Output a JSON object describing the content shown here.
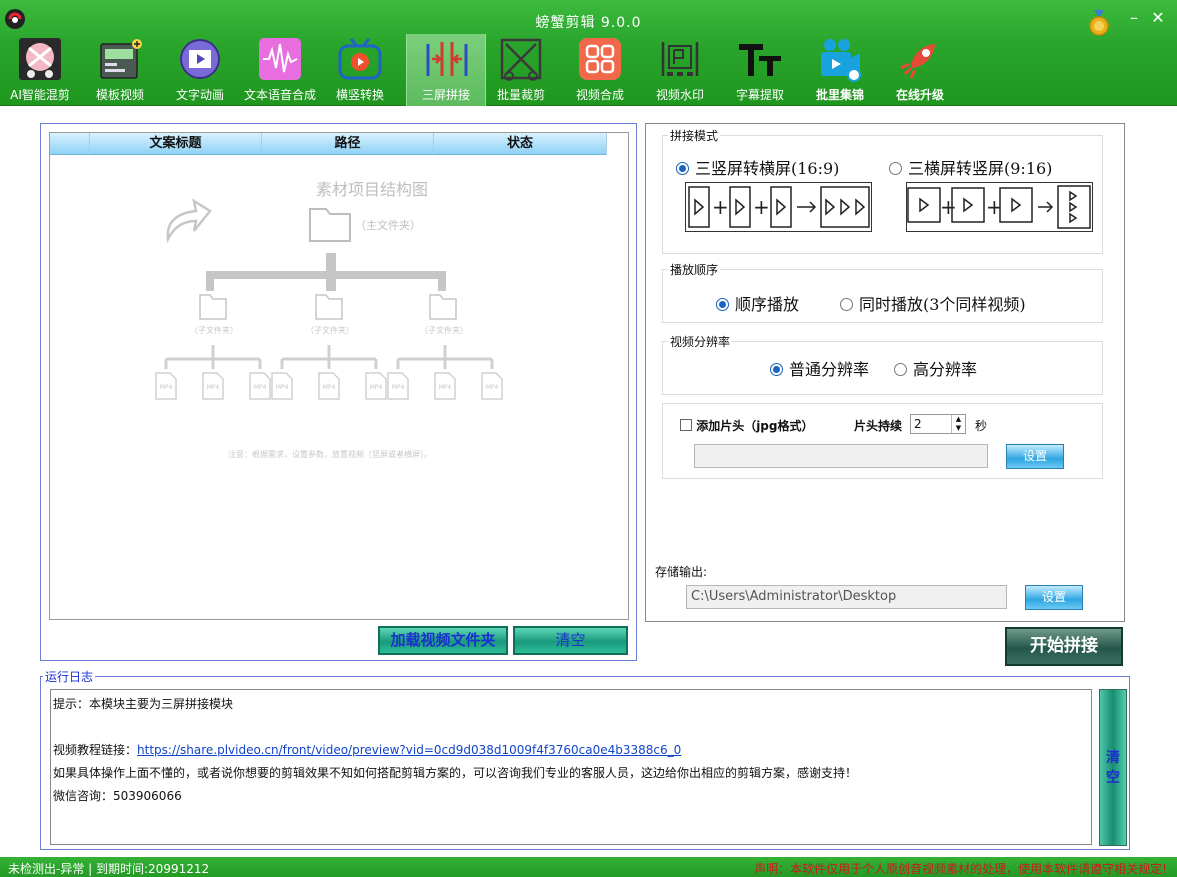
{
  "window": {
    "title": "螃蟹剪辑 9.0.0",
    "minimize": "–",
    "close": "✕"
  },
  "toolbar": [
    {
      "label": "AI智能混剪",
      "icon": "ai-mix-icon"
    },
    {
      "label": "模板视频",
      "icon": "template-video-icon"
    },
    {
      "label": "文字动画",
      "icon": "text-animation-icon"
    },
    {
      "label": "文本语音合成",
      "icon": "tts-waveform-icon"
    },
    {
      "label": "横竖转换",
      "icon": "rotate-tv-icon"
    },
    {
      "label": "三屏拼接",
      "icon": "three-screen-icon",
      "active": true
    },
    {
      "label": "批量裁剪",
      "icon": "crop-icon"
    },
    {
      "label": "视频合成",
      "icon": "video-merge-icon"
    },
    {
      "label": "视频水印",
      "icon": "watermark-icon"
    },
    {
      "label": "字幕提取",
      "icon": "subtitle-tt-icon"
    },
    {
      "label": "批里集锦",
      "icon": "camera-icon"
    },
    {
      "label": "在线升级",
      "icon": "rocket-icon"
    }
  ],
  "file_list": {
    "columns": [
      "文案标题",
      "路径",
      "状态"
    ],
    "diagram": {
      "title": "素材项目结构图",
      "main_folder": "（主文件夹）",
      "sub_folder": "（子文件夹）",
      "file_label": "MP4",
      "note": "注意：根据需求，设置参数，放置视频（竖屏或者横屏）。"
    }
  },
  "buttons": {
    "load_folder": "加载视频文件夹",
    "clear": "清空",
    "start": "开始拼接",
    "settings": "设置",
    "log_clear": "清空"
  },
  "splice_mode": {
    "title": "拼接模式",
    "option1": "三竖屏转横屏(16:9)",
    "option2": "三横屏转竖屏(9:16)",
    "selected": 1
  },
  "play_order": {
    "title": "播放顺序",
    "option1": "顺序播放",
    "option2": "同时播放(3个同样视频)",
    "selected": 1
  },
  "resolution": {
    "title": "视频分辨率",
    "option1": "普通分辨率",
    "option2": "高分辨率",
    "selected": 1
  },
  "intro": {
    "checkbox_label": "添加片头（jpg格式）",
    "duration_label": "片头持续",
    "duration_value": "2",
    "unit": "秒",
    "path_value": ""
  },
  "output": {
    "label": "存储输出:",
    "path": "C:\\Users\\Administrator\\Desktop"
  },
  "log": {
    "title": "运行日志",
    "lines": [
      "提示：本模块主要为三屏拼接模块",
      "",
      "视频教程链接：",
      "如果具体操作上面不懂的，或者说你想要的剪辑效果不知如何搭配剪辑方案的，可以咨询我们专业的客服人员，这边给你出相应的剪辑方案，感谢支持！",
      "微信咨询：503906066"
    ],
    "link": "https://share.plvideo.cn/front/video/preview?vid=0cd9d038d1009f4f3760ca0e4b3388c6_0"
  },
  "status": {
    "left": "未检测出-异常 | 到期时间:20991212",
    "right": "声明：本软件仅用于个人原创音视频素材的处理，使用本软件请遵守相关规定!"
  },
  "colors": {
    "topbar": "#2aa62c",
    "accent_blue": "#1a63c0",
    "status_red": "#c81c1c"
  }
}
